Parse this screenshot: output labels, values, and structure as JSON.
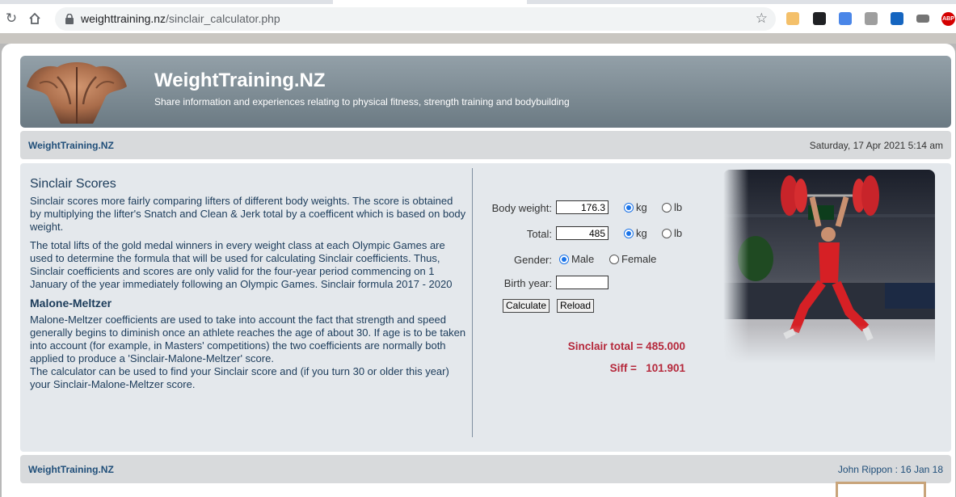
{
  "browser": {
    "url_domain": "weighttraining.nz",
    "url_path": "/sinclair_calculator.php",
    "abp_label": "ABP"
  },
  "site": {
    "title": "WeightTraining.NZ",
    "tagline": "Share information and experiences relating to physical fitness, strength training and bodybuilding"
  },
  "navbar": {
    "home_link": "WeightTraining.NZ",
    "date": "Saturday, 17 Apr 2021 5:14 am"
  },
  "article": {
    "heading": "Sinclair Scores",
    "p1": "Sinclair scores more fairly comparing lifters of different body weights. The score is obtained by multiplying the lifter's Snatch and Clean & Jerk total by a coefficent which is based on body weight.",
    "p2": "The total lifts of the gold medal winners in every weight class at each Olympic Games are used to determine the formula that will be used for calculating Sinclair coefficients. Thus, Sinclair coefficients and scores are only valid for the four-year period commencing on 1 January of the year immediately following an Olympic Games.",
    "p2_link": "Sinclair formula 2017 - 2020",
    "subheading": "Malone-Meltzer",
    "p3": "Malone-Meltzer coefficients are used to take into account the fact that strength and speed generally begins to diminish once an athlete reaches the age of about 30. If age is to be taken into account (for example, in Masters' competitions) the two coefficients are normally both applied to produce a 'Sinclair-Malone-Meltzer' score.",
    "p4": "The calculator can be used to find your Sinclair score and (if you turn 30 or older this year) your Sinclair-Malone-Meltzer score."
  },
  "form": {
    "body_weight_label": "Body weight:",
    "body_weight_value": "176.3",
    "total_label": "Total:",
    "total_value": "485",
    "unit_kg": "kg",
    "unit_lb": "lb",
    "gender_label": "Gender:",
    "gender_male": "Male",
    "gender_female": "Female",
    "birth_year_label": "Birth year:",
    "birth_year_value": "",
    "calculate_label": "Calculate",
    "reload_label": "Reload"
  },
  "results": {
    "sinclair_text": "Sinclair total = 485.000",
    "siff_text": "Siff =   101.901"
  },
  "footer": {
    "home_link": "WeightTraining.NZ",
    "credit": "John Rippon : 16 Jan 18"
  },
  "colors": {
    "banner": "#7a8891",
    "link": "#1f4e79",
    "result": "#b5283b"
  }
}
